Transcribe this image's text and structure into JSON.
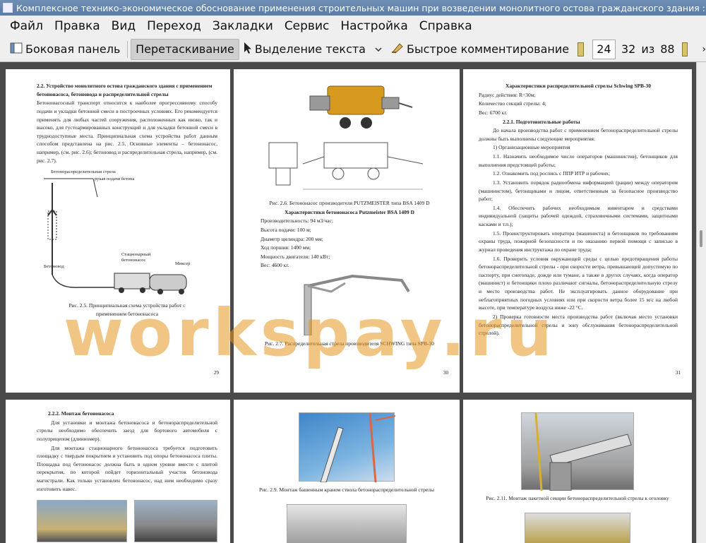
{
  "window": {
    "title": "Комплексное технико-экономическое обоснование применения строительных машин при возведении монолитного остова гражданского здания : магист"
  },
  "menu": [
    "Файл",
    "Правка",
    "Вид",
    "Переход",
    "Закладки",
    "Сервис",
    "Настройка",
    "Справка"
  ],
  "toolbar": {
    "sidebar_label": "Боковая панель",
    "drag_label": "Перетаскивание",
    "select_label": "Выделение текста",
    "comment_label": "Быстрое комментирование",
    "current_page": "24",
    "page_of_start": "32",
    "of_label": "из",
    "total_pages": "88"
  },
  "watermark": "workspay.ru",
  "pages": {
    "p29": {
      "heading": "2.2. Устройство монолитного остова гражданского здания с применением бетононасоса, бетоновода и распределительной стрелы",
      "para1": "Бетононасосный транспорт относится к наиболее прогрессивному способу подачи и укладки бетонной смеси в построечных условиях. Его рекомендуется применять для любых частей сооружения, расположенных как низко, так и высоко, для густоармированных конструкций и для укладки бетонной смеси в труднодоступные места. Принципиальная схема устройства работ данным способом представлена на рис. 2.5. Основные элементы – бетононасос, например, (см. рис. 2.6); бетоновод и распределительная стрела, например, (см. рис. 2.7).",
      "label_strela": "Бетонораспределительная стрела",
      "label_rukav": "рукав подачи бетона",
      "label_betonovod": "Бетоновод",
      "label_nasos": "Стационарный бетононасос",
      "label_mixer": "Миксер",
      "caption": "Рис. 2.5. Принципиальная схема устройства работ с применением бетононасоса",
      "number": "29"
    },
    "p30": {
      "caption1": "Рис. 2.6. Бетононасос производителя PUTZMEISTER типа BSA 1409 D",
      "heading": "Характеристики бетононасоса Putzmeister BSA 1409 D",
      "specs": [
        "Производительность: 94 м3/час;",
        "Высота подачи: 100 м;",
        "Диаметр цилиндра: 200 мм;",
        "Ход поршня: 1400 мм;",
        "Мощность двигателя: 140 кВт;",
        "Вес: 4600 кг."
      ],
      "caption2": "Рис. 2.7. Распределительная стрела производителя SCHWING типа SPB-30",
      "number": "30"
    },
    "p31": {
      "heading": "Характеристики распределительной стрелы Schwing SPB-30",
      "specs": [
        "Радиус действия: R=30м;",
        "Количество секций стрелы: 4;",
        "Вес: 6700 кг."
      ],
      "subheading": "2.2.1. Подготовительные работы",
      "intro": "До начала производства работ с применением бетонораспределительной стрелы должны быть выполнены следующие мероприятия:",
      "list_title": "1) Организационные мероприятия",
      "items": [
        "1.1. Назначить необходимое число операторов (машинистов), бетонщиков для выполнения предстоящей работы;",
        "1.2. Ознакомить под роспись с ППР ИТР и рабочих;",
        "1.3. Установить порядок радиообмена информацией (рации) между оператором (машинистом), бетонщиками и лицом, ответственным за безопасное производство работ;",
        "1.4. Обеспечить рабочих необходимым инвентарем и средствами индивидуальной (защиты рабочей одеждой, страховочными системами, защитными касками и т.п.);",
        "1.5. Проинструктировать оператора (машиниста) и бетонщиков по требованиям охраны труда, пожарной безопасности и по оказанию первой помощи с записью в журнал проведения инструктажа по охране труда;",
        "1.6. Проверить условия окружающей среды с целью предотвращения работы бетонораспределительной стрелы - при скорости ветра, превышающей допустимую по паспорту, при снегопаде, дожде или тумане, а также в других случаях, когда оператор (машинист) и бетонщики плохо различают сигналы, бетонораспределительную стрелу и место производства работ. Не эксплуатировать данное оборудование при неблагоприятных погодных условиях или при скорости ветра более 15 м/с на любой высоте, при температуре воздуха ниже -22 °С.",
        "2) Проверка готовности места производства работ (включая место установки бетонораспределительной стрелы и зону обслуживания бетонораспределительной стрелой)."
      ],
      "number": "31"
    },
    "p32": {
      "heading": "2.2.2. Монтаж бетононасоса",
      "para1": "Для установки и монтажа бетононасоса и бетонораспределительной стрелы необходимо обеспечить заезд для бортового автомобиля с полуприцепом (длинномер).",
      "para2": "Для монтажа стационарного бетононасоса требуется подготовить площадку с твердым покрытием и установить под опоры бетононасоса плиты. Площадка под бетононасос должна быть в одном уровне вместе с плитой перекрытия, по которой пойдет горизонтальный участок бетоновода магистрали. Как только установлен бетононасос, над ним необходимо сразу изготовить навес."
    },
    "p33": {
      "caption": "Рис. 2.9. Монтаж башенным краном ствола бетонораспределительной стрелы"
    },
    "p34": {
      "caption": "Рис. 2.11. Монтаж пакетной секции бетонораспределительной стрелы к оголовку"
    }
  }
}
